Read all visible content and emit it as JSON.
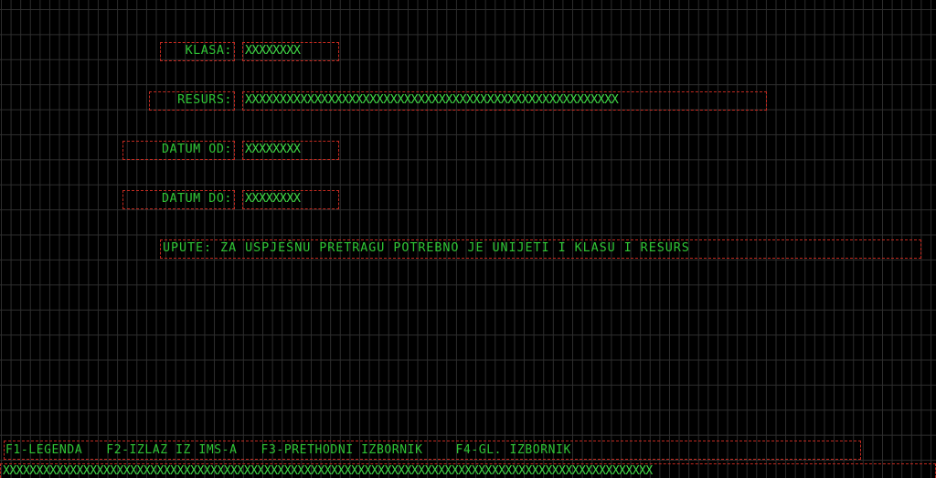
{
  "form": {
    "klasa": {
      "label": "KLASA:",
      "value": "XXXXXXXX"
    },
    "resurs": {
      "label": "RESURS:",
      "value": "XXXXXXXXXXXXXXXXXXXXXXXXXXXXXXXXXXXXXXXXXXXXXXXXXXXXXX"
    },
    "datum_od": {
      "label": "DATUM OD:",
      "value": "XXXXXXXX"
    },
    "datum_do": {
      "label": "DATUM DO:",
      "value": "XXXXXXXX"
    }
  },
  "hint": "UPUTE: ZA USPJEŠNU PRETRAGU POTREBNO JE UNIJETI I KLASU I RESURS",
  "function_keys": [
    {
      "label": "F1-LEGENDA"
    },
    {
      "label": "F2-IZLAZ IZ IMS-A"
    },
    {
      "label": "F3-PRETHODNI IZBORNIK"
    },
    {
      "label": "F4-GL. IZBORNIK"
    }
  ],
  "status_line": "XXXXXXXXXXXXXXXXXXXXXXXXXXXXXXXXXXXXXXXXXXXXXXXXXXXXXXXXXXXXXXXXXXXXXXXXXXXXXXXXXXXXXXXXXXXXXXXXX",
  "colors": {
    "background": "#000000",
    "grid": "#2e2e2e",
    "text": "#2fc535",
    "field_border": "#c0291f"
  }
}
